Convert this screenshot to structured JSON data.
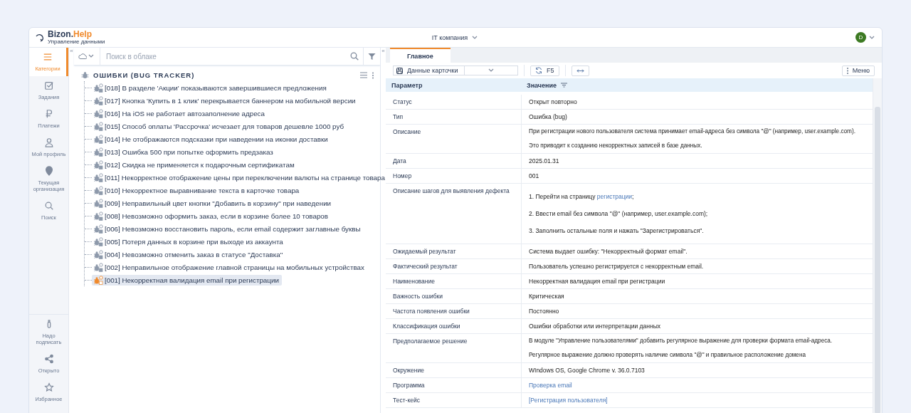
{
  "header": {
    "brand": "Bizon.",
    "brand_accent": "Help",
    "subtitle": "Управление данными",
    "company": "IT компания",
    "avatar": "D"
  },
  "nav": [
    {
      "kind": "menu",
      "label": "Категории",
      "selected": true
    },
    {
      "kind": "tasks",
      "label": "Задания",
      "selected": false
    },
    {
      "kind": "payments",
      "label": "Платежи",
      "selected": false
    },
    {
      "kind": "profile",
      "label": "Мой профиль",
      "selected": false
    },
    {
      "kind": "org",
      "label": "Текущая организация",
      "selected": false
    },
    {
      "kind": "search",
      "label": "Поиск",
      "selected": false
    }
  ],
  "nav_bottom": [
    {
      "kind": "sign",
      "label": "Надо подписать",
      "selected": false
    },
    {
      "kind": "share",
      "label": "Открыто",
      "selected": false
    },
    {
      "kind": "star",
      "label": "Избранное",
      "selected": false
    }
  ],
  "collapse_left": "«",
  "collapse_right": "«",
  "search": {
    "placeholder": "Поиск в облаке"
  },
  "tree": {
    "title": "ОШИБКИ (BUG TRACKER)",
    "children": [
      {
        "label": "[018] В разделе 'Акции' показываются завершившиеся предложения",
        "selected": false
      },
      {
        "label": "[017] Кнопка 'Купить в 1 клик' перекрывается баннером на мобильной версии",
        "selected": false
      },
      {
        "label": "[016] На iOS не работает автозаполнение адреса",
        "selected": false
      },
      {
        "label": "[015] Способ оплаты 'Рассрочка' исчезает для товаров дешевле 1000 руб",
        "selected": false
      },
      {
        "label": "[014] Не отображаются подсказки при наведении на иконки доставки",
        "selected": false
      },
      {
        "label": "[013] Ошибка 500 при попытке оформить предзаказ",
        "selected": false
      },
      {
        "label": "[012] Скидка не применяется к подарочным сертификатам",
        "selected": false
      },
      {
        "label": "[011] Некорректное отображение цены при переключении валюты на странице товара",
        "selected": false
      },
      {
        "label": "[010] Некорректное выравнивание текста в карточке товара",
        "selected": false
      },
      {
        "label": "[009] Неправильный цвет кнопки \"Добавить в корзину\" при наведении",
        "selected": false
      },
      {
        "label": "[008] Невозможно оформить заказ, если в корзине более 10 товаров",
        "selected": false
      },
      {
        "label": "[006] Невозможно восстановить пароль, если email содержит заглавные буквы",
        "selected": false
      },
      {
        "label": "[005] Потеря данных в корзине при выходе из аккаунта",
        "selected": false
      },
      {
        "label": "[004] Невозможно отменить заказ в статусе \"Доставка\"",
        "selected": false
      },
      {
        "label": "[002] Неправильное отображение главной страницы на мобильных устройствах",
        "selected": false
      },
      {
        "label": "[001] Некорректная валидация email при регистрации",
        "selected": true
      }
    ]
  },
  "tabs": [
    {
      "label": "Главное",
      "selected": true
    }
  ],
  "toolbar": {
    "card_select": "Данные карточки",
    "refresh": "F5",
    "menu": "Меню"
  },
  "table": {
    "columns": [
      "Параметр",
      "Значение"
    ],
    "rows": [
      {
        "kind": "text",
        "param": "Статус",
        "value": "Открыт повторно"
      },
      {
        "kind": "text",
        "param": "Тип",
        "value": "Ошибка (bug)"
      },
      {
        "kind": "paragraphs",
        "param": "Описание",
        "paragraphs": [
          "При регистрации нового пользователя система принимает email-адреса без символа \"@\" (например, user.example.com).",
          "Это приводит к созданию некорректных записей в базе данных."
        ]
      },
      {
        "kind": "text",
        "param": "Дата",
        "value": "2025.01.31"
      },
      {
        "kind": "text",
        "param": "Номер",
        "value": "001"
      },
      {
        "kind": "steps",
        "param": "Описание шагов для выявления дефекта",
        "steps": [
          {
            "number": "1.",
            "text": "Перейти на страницу ",
            "link": "регистрации",
            "tail": ";"
          },
          {
            "number": "2.",
            "text": "Ввести email без символа \"@\" (например, user.example.com);"
          },
          {
            "number": "3.",
            "text": "Заполнить остальные поля и нажать \"Зарегистрироваться\"."
          }
        ]
      },
      {
        "kind": "text",
        "param": "Ожидаемый результат",
        "value": "Система выдает ошибку: \"Некорректный формат email\"."
      },
      {
        "kind": "text",
        "param": "Фактический результат",
        "value": "Пользователь успешно регистрируется с некорректным email."
      },
      {
        "kind": "text",
        "param": "Наименование",
        "value": "Некорректная валидация email при регистрации"
      },
      {
        "kind": "text",
        "param": "Важность ошибки",
        "value": "Критическая"
      },
      {
        "kind": "text",
        "param": "Частота появления ошибки",
        "value": "Постоянно"
      },
      {
        "kind": "text",
        "param": "Классификация ошибки",
        "value": "Ошибки обработки или интерпретации данных"
      },
      {
        "kind": "paragraphs",
        "param": "Предполагаемое решение",
        "paragraphs": [
          "В модуле \"Управление пользователями\" добавить регулярное выражение для проверки формата email-адреса.",
          "Регулярное выражение должно проверять наличие символа \"@\" и правильное расположение домена"
        ]
      },
      {
        "kind": "text",
        "param": "Окружение",
        "value": "WIndows OS, Google Chrome v. 36.0.7103"
      },
      {
        "kind": "link",
        "param": "Программа",
        "value": "Проверка email"
      },
      {
        "kind": "link",
        "param": "Тест-кейс",
        "value": "[Регистрация пользователя]"
      }
    ]
  }
}
